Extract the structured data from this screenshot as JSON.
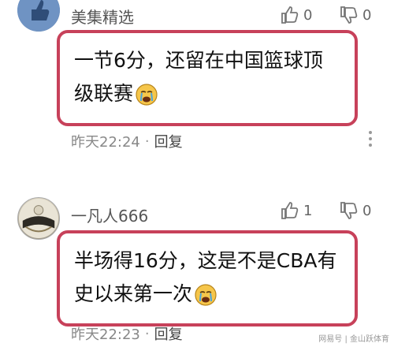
{
  "comments": [
    {
      "username": "美集精选",
      "likes": "0",
      "dislikes": "0",
      "text": "一节6分，还留在中国篮球顶级联赛",
      "time": "昨天22:24",
      "separator": "·",
      "reply_label": "回复"
    },
    {
      "username": "一凡人666",
      "likes": "1",
      "dislikes": "0",
      "text": "半场得16分，这是不是CBA有史以来第一次",
      "time": "昨天22:23",
      "separator": "·",
      "reply_label": "回复"
    }
  ],
  "watermark": "网易号 | 金山跃体育",
  "colors": {
    "highlight_border": "#c7415a",
    "meta_text": "#888888"
  },
  "icons": [
    "thumbs-up-icon",
    "thumbs-down-icon",
    "crying-face-emoji",
    "more-dots-icon"
  ]
}
